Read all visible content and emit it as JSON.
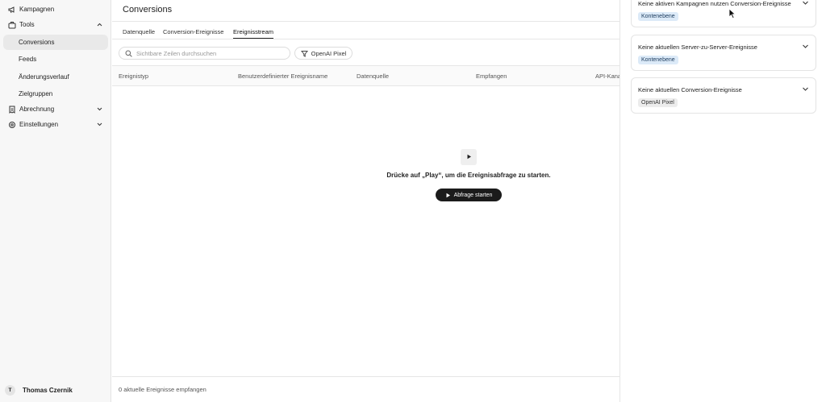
{
  "sidebar": {
    "items": [
      {
        "label": "Kampagnen",
        "icon": "megaphone-icon"
      },
      {
        "label": "Tools",
        "icon": "briefcase-icon",
        "chevron": "up"
      },
      {
        "label": "Conversions"
      },
      {
        "label": "Feeds"
      },
      {
        "label": "Änderungsverlauf"
      },
      {
        "label": "Zielgruppen"
      },
      {
        "label": "Abrechnung",
        "icon": "receipt-icon",
        "chevron": "down"
      },
      {
        "label": "Einstellungen",
        "icon": "gear-icon",
        "chevron": "down"
      }
    ],
    "user": {
      "initial": "T",
      "name": "Thomas Czernik"
    }
  },
  "main": {
    "title": "Conversions",
    "tabs": [
      {
        "label": "Datenquelle"
      },
      {
        "label": "Conversion-Ereignisse"
      },
      {
        "label": "Ereignisstream",
        "active": true
      }
    ],
    "search_placeholder": "Sichtbare Zeilen durchsuchen",
    "filter_label": "OpenAI Pixel",
    "columns": [
      "Ereignistyp",
      "Benutzerdefinierter Ereignisname",
      "Datenquelle",
      "Empfangen",
      "API-Kana"
    ],
    "empty_message": "Drücke auf „Play“, um die Ereignisabfrage zu starten.",
    "start_button": "Abfrage starten",
    "footer": "0 aktuelle Ereignisse empfangen"
  },
  "panel": {
    "cards": [
      {
        "title": "Keine aktiven Kampagnen nutzen Conversion-Ereignisse",
        "badge": "Kontenebene",
        "badge_color": "#dceaf8"
      },
      {
        "title": "Keine aktuellen Server-zu-Server-Ereignisse",
        "badge": "Kontenebene",
        "badge_color": "#dceaf8"
      },
      {
        "title": "Keine aktuellen Conversion-Ereignisse",
        "badge": "OpenAI Pixel",
        "badge_color": "#ececec"
      }
    ]
  },
  "colors": {
    "accent_dark": "#1b1b1b",
    "sidebar_bg": "#f7f7f7",
    "active_item_bg": "#e9e9e9"
  }
}
